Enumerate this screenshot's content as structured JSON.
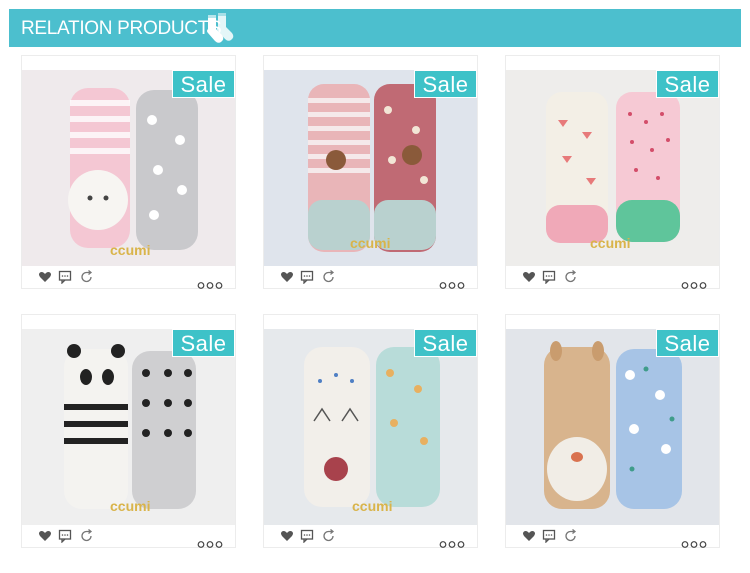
{
  "header": {
    "title": "RELATION PRODUCTS",
    "icon": "socks-icon"
  },
  "colors": {
    "banner": "#4cbfce",
    "sale_badge": "#3ec2c8",
    "icon_gray": "#555555"
  },
  "cards": [
    {
      "badge": "Sale",
      "brand": "ccumi",
      "theme": "cat-stripes-pink-gray"
    },
    {
      "badge": "Sale",
      "brand": "ccumi",
      "theme": "monkey-red"
    },
    {
      "badge": "Sale",
      "brand": "ccumi",
      "theme": "watermelon-strawberry"
    },
    {
      "badge": "Sale",
      "brand": "ccumi",
      "theme": "panda-black-white"
    },
    {
      "badge": "Sale",
      "brand": "ccumi",
      "theme": "cat-blue-dots"
    },
    {
      "badge": "Sale",
      "brand": "",
      "theme": "deer-blue"
    }
  ],
  "actions": {
    "like": "heart-icon",
    "comment": "comment-icon",
    "share": "share-icon",
    "more": "more-icon"
  }
}
